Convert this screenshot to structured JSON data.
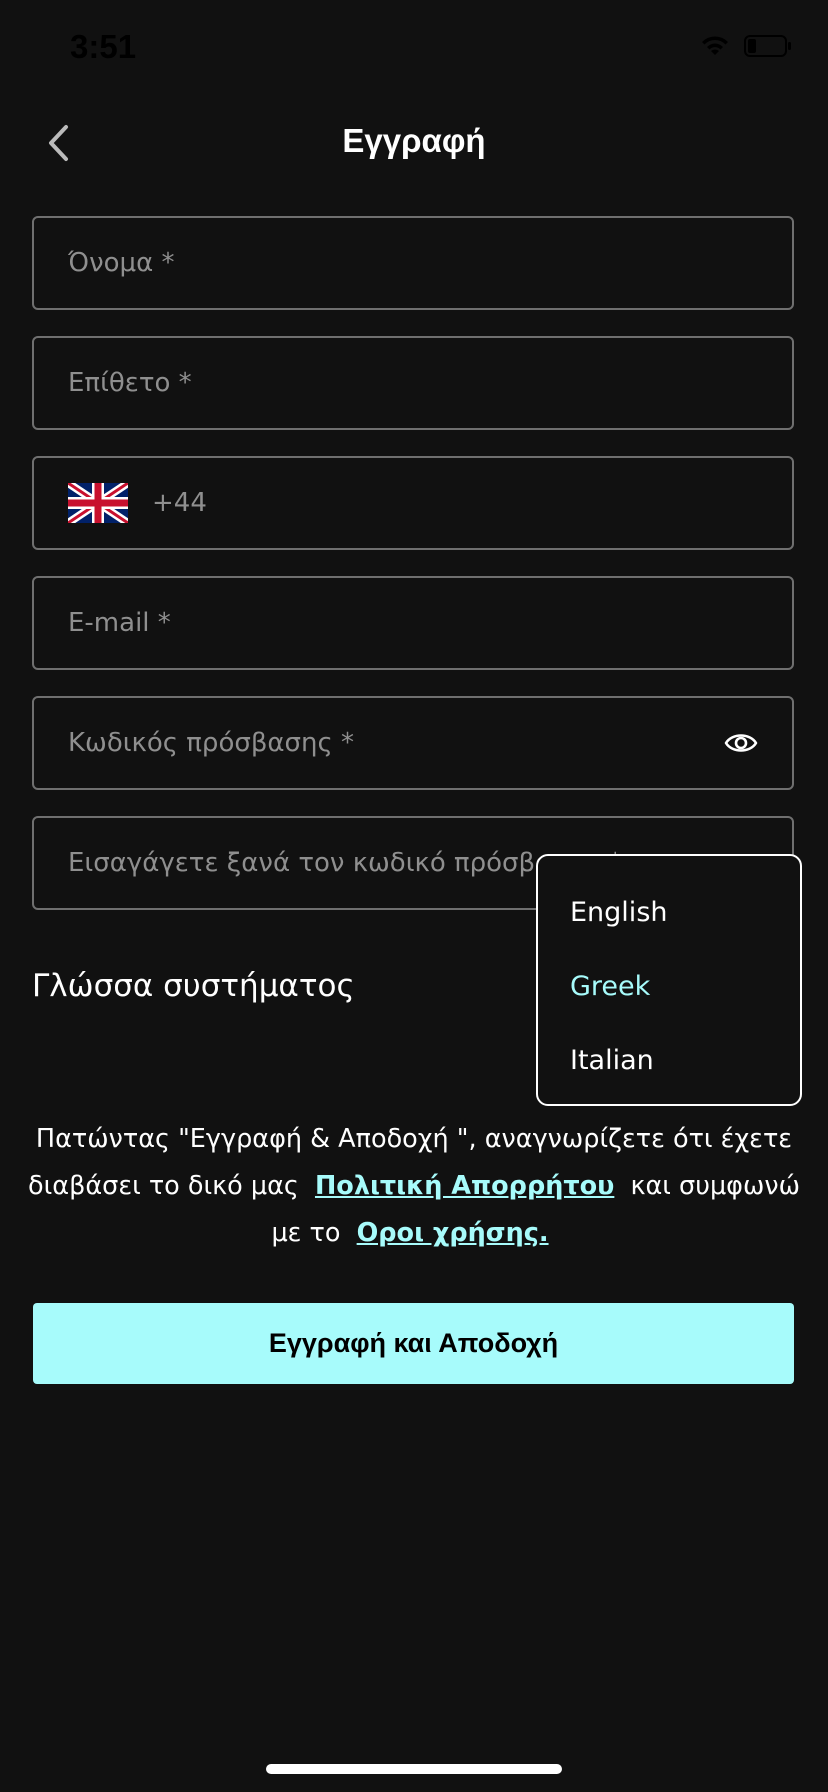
{
  "status_bar": {
    "time": "3:51",
    "wifi_icon": "wifi-icon",
    "battery_icon": "battery-icon"
  },
  "header": {
    "title": "Εγγραφή",
    "back_icon": "chevron-left-icon"
  },
  "form": {
    "first_name": {
      "placeholder": "Όνομα *",
      "value": ""
    },
    "last_name": {
      "placeholder": "Επίθετο *",
      "value": ""
    },
    "phone": {
      "placeholder": "+44",
      "value": "",
      "country_flag": "uk-flag-icon"
    },
    "email": {
      "placeholder": "E-mail *",
      "value": ""
    },
    "password": {
      "placeholder": "Κωδικός πρόσβασης *",
      "value": "",
      "toggle_icon": "eye-icon"
    },
    "password_confirm": {
      "placeholder": "Εισαγάγετε ξανά τον κωδικό πρόσβασης *",
      "value": "",
      "toggle_icon": "eye-icon"
    }
  },
  "language": {
    "label": "Γλώσσα συστήματος",
    "options": [
      "English",
      "Greek",
      "Italian"
    ],
    "selected": "Greek"
  },
  "consent": {
    "text_before": "Πατώντας \"Εγγραφή & Αποδοχή \", αναγνωρίζετε ότι έχετε διαβάσει το δικό μας",
    "privacy_link": "Πολιτική Απορρήτου",
    "text_middle": "και συμφωνώ με το",
    "terms_link": "Οροι χρήσης."
  },
  "submit": {
    "label": "Εγγραφή και Αποδοχή"
  },
  "colors": {
    "background": "#111111",
    "accent": "#a7fbfb",
    "border": "#6f6f6f",
    "placeholder": "#8f8f8f"
  }
}
